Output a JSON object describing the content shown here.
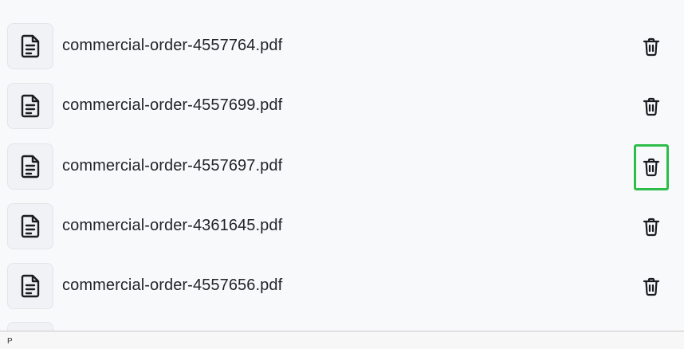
{
  "files": [
    {
      "name": "commercial-order-4557764.pdf",
      "icon": "document-icon",
      "action_icon": "trash-icon"
    },
    {
      "name": "commercial-order-4557699.pdf",
      "icon": "document-icon",
      "action_icon": "trash-icon"
    },
    {
      "name": "commercial-order-4557697.pdf",
      "icon": "document-icon",
      "action_icon": "trash-icon",
      "highlighted": true
    },
    {
      "name": "commercial-order-4361645.pdf",
      "icon": "document-icon",
      "action_icon": "trash-icon"
    },
    {
      "name": "commercial-order-4557656.pdf",
      "icon": "document-icon",
      "action_icon": "trash-icon"
    }
  ],
  "status_bar": {
    "text": "P"
  },
  "colors": {
    "highlight": "#2ebd4a",
    "background": "#f8f9fb",
    "text": "#222428"
  }
}
